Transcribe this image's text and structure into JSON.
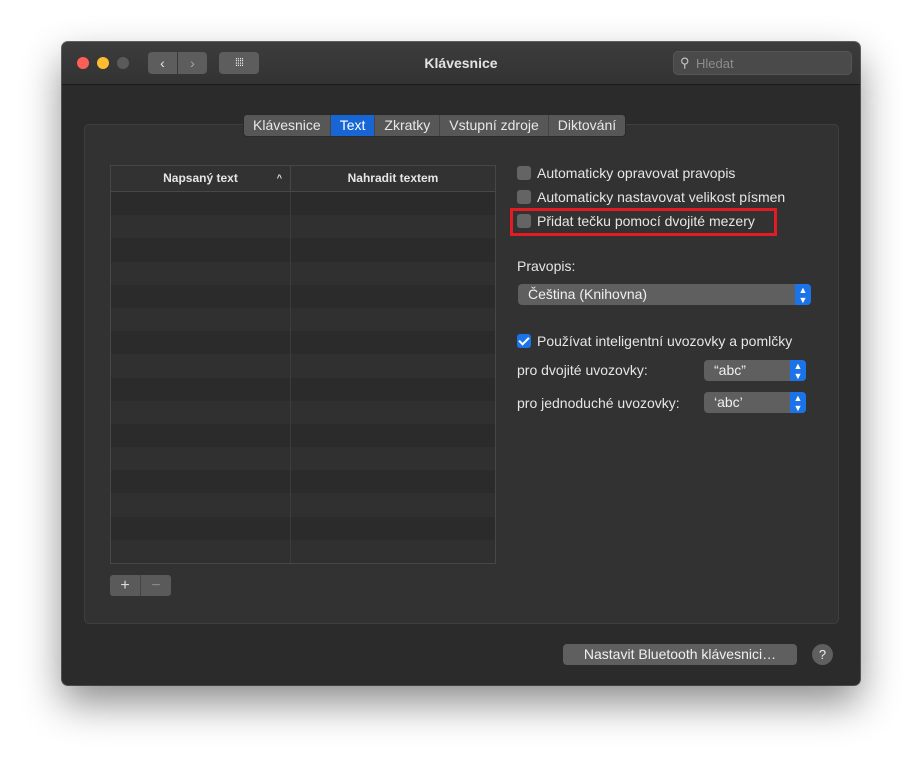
{
  "window": {
    "title": "Klávesnice",
    "search_placeholder": "Hledat",
    "nav_back": "‹",
    "nav_forward": "›",
    "grid_icon": "⁞⁞⁞⁞"
  },
  "tabs": [
    {
      "label": "Klávesnice",
      "active": false
    },
    {
      "label": "Text",
      "active": true
    },
    {
      "label": "Zkratky",
      "active": false
    },
    {
      "label": "Vstupní zdroje",
      "active": false
    },
    {
      "label": "Diktování",
      "active": false
    }
  ],
  "table": {
    "col1": "Napsaný text",
    "col1_sort": "^",
    "col2": "Nahradit textem",
    "rows": []
  },
  "list_buttons": {
    "add": "+",
    "remove": "−"
  },
  "options": {
    "auto_correct": {
      "label": "Automaticky opravovat pravopis",
      "checked": false
    },
    "auto_capitalize": {
      "label": "Automaticky nastavovat velikost písmen",
      "checked": false
    },
    "double_space_period": {
      "label": "Přidat tečku pomocí dvojité mezery",
      "checked": false
    },
    "spelling_label": "Pravopis:",
    "spelling_value": "Čeština (Knihovna)",
    "smart_quotes": {
      "label": "Používat inteligentní uvozovky a pomlčky",
      "checked": true
    },
    "double_quotes_label": "pro dvojité uvozovky:",
    "double_quotes_value": "“abc”",
    "single_quotes_label": "pro jednoduché uvozovky:",
    "single_quotes_value": "‘abc’"
  },
  "footer": {
    "bluetooth_button": "Nastavit Bluetooth klávesnici…",
    "help": "?"
  },
  "colors": {
    "accent": "#1a73e8",
    "highlight": "#e31b23"
  }
}
